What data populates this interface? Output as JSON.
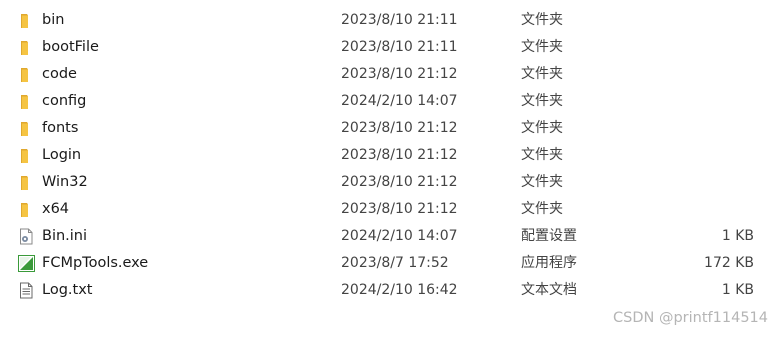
{
  "files": [
    {
      "name": "bin",
      "modified": "2023/8/10 21:11",
      "type": "文件夹",
      "size": "",
      "icon": "folder-icon"
    },
    {
      "name": "bootFile",
      "modified": "2023/8/10 21:11",
      "type": "文件夹",
      "size": "",
      "icon": "folder-icon"
    },
    {
      "name": "code",
      "modified": "2023/8/10 21:12",
      "type": "文件夹",
      "size": "",
      "icon": "folder-icon"
    },
    {
      "name": "config",
      "modified": "2024/2/10 14:07",
      "type": "文件夹",
      "size": "",
      "icon": "folder-icon"
    },
    {
      "name": "fonts",
      "modified": "2023/8/10 21:12",
      "type": "文件夹",
      "size": "",
      "icon": "folder-icon"
    },
    {
      "name": "Login",
      "modified": "2023/8/10 21:12",
      "type": "文件夹",
      "size": "",
      "icon": "folder-icon"
    },
    {
      "name": "Win32",
      "modified": "2023/8/10 21:12",
      "type": "文件夹",
      "size": "",
      "icon": "folder-icon"
    },
    {
      "name": "x64",
      "modified": "2023/8/10 21:12",
      "type": "文件夹",
      "size": "",
      "icon": "folder-icon"
    },
    {
      "name": "Bin.ini",
      "modified": "2024/2/10 14:07",
      "type": "配置设置",
      "size": "1 KB",
      "icon": "settings-file-icon"
    },
    {
      "name": "FCMpTools.exe",
      "modified": "2023/8/7 17:52",
      "type": "应用程序",
      "size": "172 KB",
      "icon": "application-icon"
    },
    {
      "name": "Log.txt",
      "modified": "2024/2/10 16:42",
      "type": "文本文档",
      "size": "1 KB",
      "icon": "text-file-icon"
    }
  ],
  "watermark": "CSDN @printf114514",
  "colors": {
    "folder": "#f5c443",
    "folder_dark": "#e0a82e",
    "exe_green": "#3a9a3a",
    "secondary_text": "#444444",
    "watermark": "#b5b5b5"
  }
}
